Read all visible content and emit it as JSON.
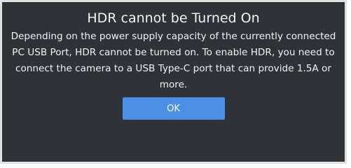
{
  "dialog": {
    "title": "HDR cannot be Turned On",
    "message": "Depending on the power supply capacity of the currently connected PC USB Port, HDR cannot be turned on. To enable HDR, you need to connect the camera to a USB Type-C port that can provide 1.5A or more.",
    "ok_label": "OK"
  },
  "colors": {
    "dialog_background": "#2f3237",
    "dialog_border": "#e1e1e1",
    "text": "#f3f3f3",
    "button_background": "#4b8fe6"
  }
}
